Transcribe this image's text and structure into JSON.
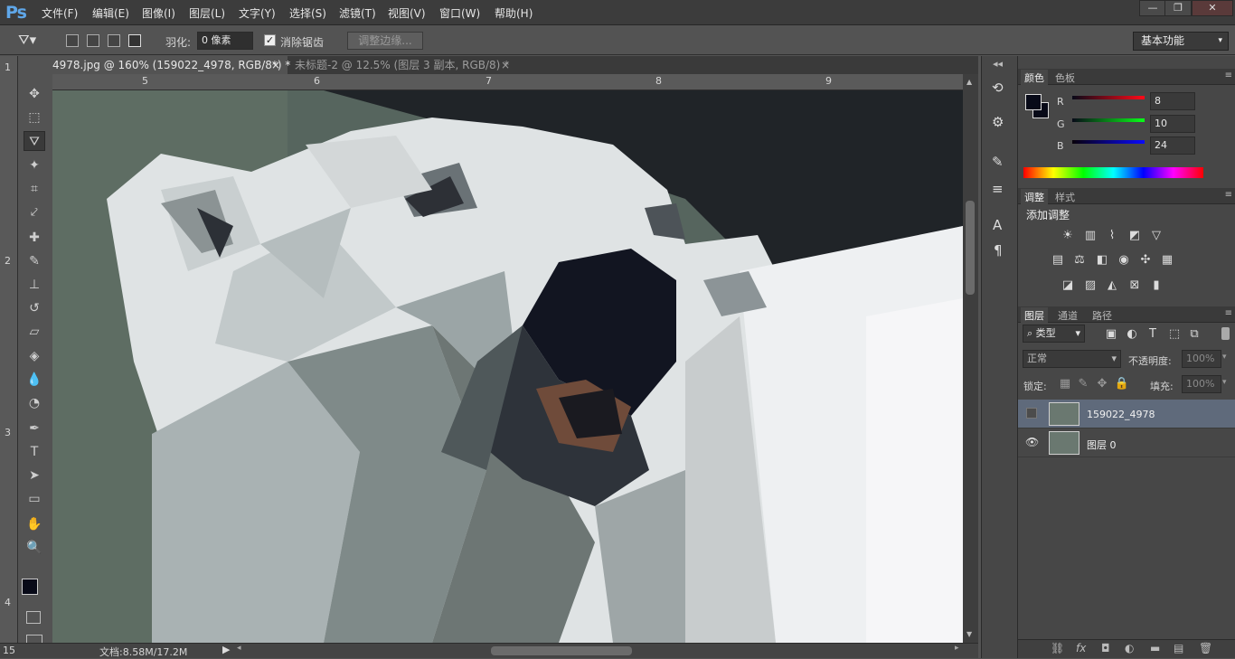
{
  "app": {
    "logo": "Ps"
  },
  "menu": [
    "文件(F)",
    "编辑(E)",
    "图像(I)",
    "图层(L)",
    "文字(Y)",
    "选择(S)",
    "滤镜(T)",
    "视图(V)",
    "窗口(W)",
    "帮助(H)"
  ],
  "window_controls": {
    "minimize": "—",
    "restore": "❐",
    "close": "✕"
  },
  "options": {
    "feather_label": "羽化:",
    "feather_value": "0 像素",
    "antialias_label": "消除锯齿",
    "antialias_checked": true,
    "refine_edge": "调整边缘...",
    "workspace": "基本功能"
  },
  "tabs": [
    {
      "title": "4978.jpg @ 160% (159022_4978, RGB/8*) *",
      "close": "×",
      "active": true
    },
    {
      "title": "未标题-2 @ 12.5% (图层 3 副本, RGB/8) *",
      "close": "×",
      "active": false
    }
  ],
  "ruler_h": [
    "5",
    "6",
    "7",
    "8",
    "9"
  ],
  "ruler_v": [
    "1",
    "2",
    "3",
    "4"
  ],
  "tools": [
    {
      "name": "move-tool-icon",
      "glyph": "✥"
    },
    {
      "name": "marquee-tool-icon",
      "glyph": "⬚"
    },
    {
      "name": "polygonal-lasso-tool-icon",
      "glyph": "⛛",
      "active": true
    },
    {
      "name": "magic-wand-tool-icon",
      "glyph": "✦"
    },
    {
      "name": "crop-tool-icon",
      "glyph": "⌗"
    },
    {
      "name": "eyedropper-tool-icon",
      "glyph": "⤦"
    },
    {
      "name": "healing-brush-tool-icon",
      "glyph": "✚"
    },
    {
      "name": "brush-tool-icon",
      "glyph": "✎"
    },
    {
      "name": "clone-stamp-tool-icon",
      "glyph": "⊥"
    },
    {
      "name": "history-brush-tool-icon",
      "glyph": "↺"
    },
    {
      "name": "eraser-tool-icon",
      "glyph": "▱"
    },
    {
      "name": "paint-bucket-tool-icon",
      "glyph": "◈"
    },
    {
      "name": "blur-tool-icon",
      "glyph": "💧"
    },
    {
      "name": "dodge-tool-icon",
      "glyph": "◔"
    },
    {
      "name": "pen-tool-icon",
      "glyph": "✒"
    },
    {
      "name": "type-tool-icon",
      "glyph": "T"
    },
    {
      "name": "path-selection-tool-icon",
      "glyph": "➤"
    },
    {
      "name": "rectangle-tool-icon",
      "glyph": "▭"
    },
    {
      "name": "hand-tool-icon",
      "glyph": "✋"
    },
    {
      "name": "zoom-tool-icon",
      "glyph": "🔍"
    }
  ],
  "status": {
    "zoom": "15",
    "doc": "文档:8.58M/17.2M"
  },
  "color_panel": {
    "tabs": [
      "颜色",
      "色板"
    ],
    "r_label": "R",
    "r_value": "8",
    "g_label": "G",
    "g_value": "10",
    "b_label": "B",
    "b_value": "24",
    "foreground": "#080a18",
    "background": "#ffffff"
  },
  "adjust_panel": {
    "tabs": [
      "调整",
      "样式"
    ],
    "heading": "添加调整"
  },
  "layers_panel": {
    "tabs": [
      "图层",
      "通道",
      "路径"
    ],
    "filter_kind": "类型",
    "blend_mode": "正常",
    "opacity_label": "不透明度:",
    "opacity_value": "100%",
    "lock_label": "锁定:",
    "fill_label": "填充:",
    "fill_value": "100%",
    "layers": [
      {
        "name": "159022_4978",
        "visible": false,
        "selected": true
      },
      {
        "name": "图层 0",
        "visible": true,
        "selected": false
      }
    ]
  }
}
